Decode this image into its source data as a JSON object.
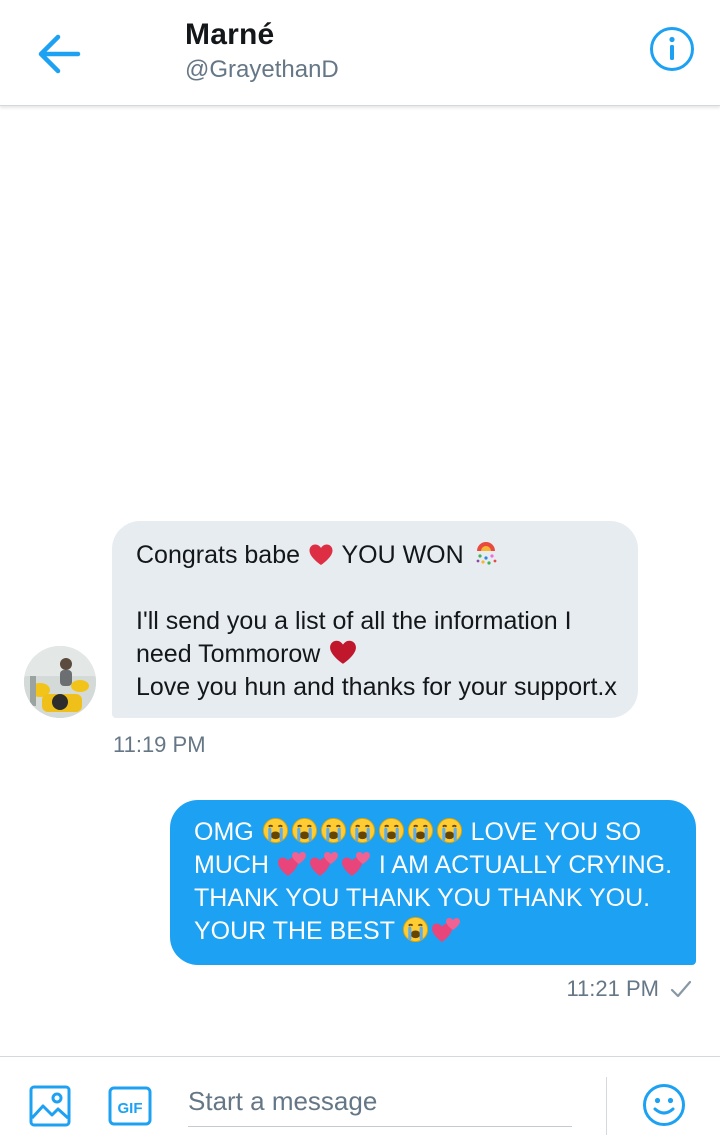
{
  "header": {
    "contact_name": "Marné",
    "contact_handle": "@GrayethanD"
  },
  "conversation": {
    "received": {
      "lines": [
        "Congrats babe",
        "YOU WON",
        "I'll send you a list of all the information I",
        "need Tommorow",
        "Love you hun and thanks for your support.x"
      ],
      "emojis": [
        "red-heart-emoji",
        "confetti-emoji",
        "red-heart-emoji"
      ],
      "timestamp": "11:19 PM"
    },
    "sent": {
      "lines": [
        "OMG",
        "LOVE YOU SO",
        "MUCH",
        "I AM ACTUALLY CRYING.",
        "THANK YOU THANK YOU THANK YOU.",
        "YOUR THE BEST"
      ],
      "emojis": [
        "loudly-crying-face-emoji",
        "two-hearts-emoji"
      ],
      "timestamp": "11:21 PM",
      "status_icon": "checkmark-icon"
    }
  },
  "composer": {
    "placeholder": "Start a message",
    "gif_label": "GIF"
  },
  "colors": {
    "accent": "#1da1f2",
    "received_bubble": "#e6ecf0",
    "secondary_text": "#657786",
    "primary_text": "#14171a"
  }
}
